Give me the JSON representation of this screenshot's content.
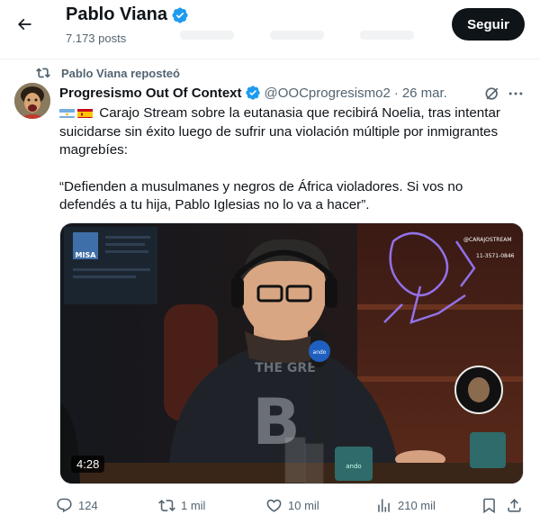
{
  "header": {
    "name": "Pablo Viana",
    "posts_count": "7.173 posts",
    "follow_label": "Seguir"
  },
  "repost": {
    "text": "Pablo Viana reposteó"
  },
  "tweet": {
    "author_name": "Progresismo Out Of Context",
    "handle": "@OOCprogresismo2",
    "separator": "·",
    "date": "26 mar.",
    "line1": "Carajo Stream sobre la eutanasia que recibirá Noelia, tras intentar suicidarse sin éxito luego de sufrir una violación múltiple por inmigrantes magrebíes:",
    "line2": "“Defienden a musulmanes y negros de África violadores. Si vos no defendés a tu hija, Pablo Iglesias no lo va a hacer”.",
    "media": {
      "duration": "4:28",
      "overlay_handle": "@CARAJOSTREAM",
      "overlay_phone": "11-3571-0846",
      "overlay_logo": "MISA",
      "mic_text": "ando",
      "mug_text": "ando"
    },
    "flags": [
      "argentina-flag",
      "spain-flag"
    ]
  },
  "actions": {
    "replies": "124",
    "reposts": "1 mil",
    "likes": "10 mil",
    "views": "210 mil"
  },
  "colors": {
    "verified": "#1d9bf0",
    "muted": "#536471",
    "text": "#0f1419",
    "neon": "#9b7bff"
  },
  "icons": [
    "back-arrow-icon",
    "verified-icon",
    "repost-icon",
    "grok-icon",
    "more-icon",
    "reply-icon",
    "like-icon",
    "views-icon",
    "bookmark-icon",
    "share-icon"
  ]
}
